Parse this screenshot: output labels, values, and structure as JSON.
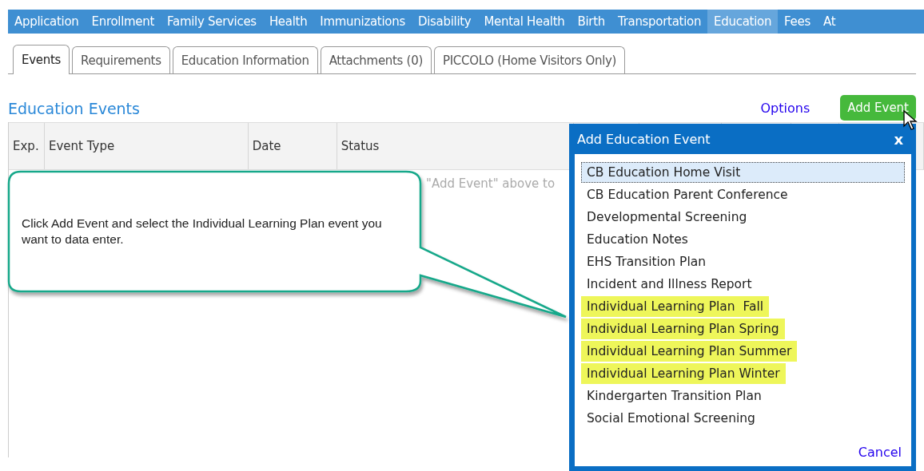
{
  "nav": [
    {
      "label": "Application",
      "selected": false
    },
    {
      "label": "Enrollment",
      "selected": false
    },
    {
      "label": "Family Services",
      "selected": false
    },
    {
      "label": "Health",
      "selected": false
    },
    {
      "label": "Immunizations",
      "selected": false
    },
    {
      "label": "Disability",
      "selected": false
    },
    {
      "label": "Mental Health",
      "selected": false
    },
    {
      "label": "Birth",
      "selected": false
    },
    {
      "label": "Transportation",
      "selected": false
    },
    {
      "label": "Education",
      "selected": true
    },
    {
      "label": "Fees",
      "selected": false
    },
    {
      "label": "At",
      "selected": false
    }
  ],
  "tabs": [
    {
      "label": "Events",
      "selected": true
    },
    {
      "label": "Requirements",
      "selected": false
    },
    {
      "label": "Education Information",
      "selected": false
    },
    {
      "label": "Attachments (0)",
      "selected": false
    },
    {
      "label": "PICCOLO (Home Visitors Only)",
      "selected": false
    }
  ],
  "section_title": "Education Events",
  "options_link": "Options",
  "add_button": "Add Event",
  "table": {
    "columns": [
      "Exp.",
      "Event Type",
      "Date",
      "Status"
    ],
    "empty_message": "\"Add Event\" above to"
  },
  "callout": {
    "text": "Click Add Event and select the Individual Learning Plan event you want to data enter."
  },
  "dialog": {
    "title": "Add Education Event",
    "close": "x",
    "cancel": "Cancel",
    "items": [
      {
        "label": "CB Education Home Visit",
        "selected": true,
        "highlighted": false
      },
      {
        "label": "CB Education Parent Conference",
        "selected": false,
        "highlighted": false
      },
      {
        "label": "Developmental Screening",
        "selected": false,
        "highlighted": false
      },
      {
        "label": "Education Notes",
        "selected": false,
        "highlighted": false
      },
      {
        "label": "EHS Transition Plan",
        "selected": false,
        "highlighted": false
      },
      {
        "label": "Incident and Illness Report",
        "selected": false,
        "highlighted": false
      },
      {
        "label": "Individual Learning Plan  Fall",
        "selected": false,
        "highlighted": true
      },
      {
        "label": "Individual Learning Plan Spring",
        "selected": false,
        "highlighted": true
      },
      {
        "label": "Individual Learning Plan Summer",
        "selected": false,
        "highlighted": true
      },
      {
        "label": "Individual Learning Plan Winter",
        "selected": false,
        "highlighted": true
      },
      {
        "label": "Kindergarten Transition Plan",
        "selected": false,
        "highlighted": false
      },
      {
        "label": "Social Emotional Screening",
        "selected": false,
        "highlighted": false
      }
    ]
  }
}
